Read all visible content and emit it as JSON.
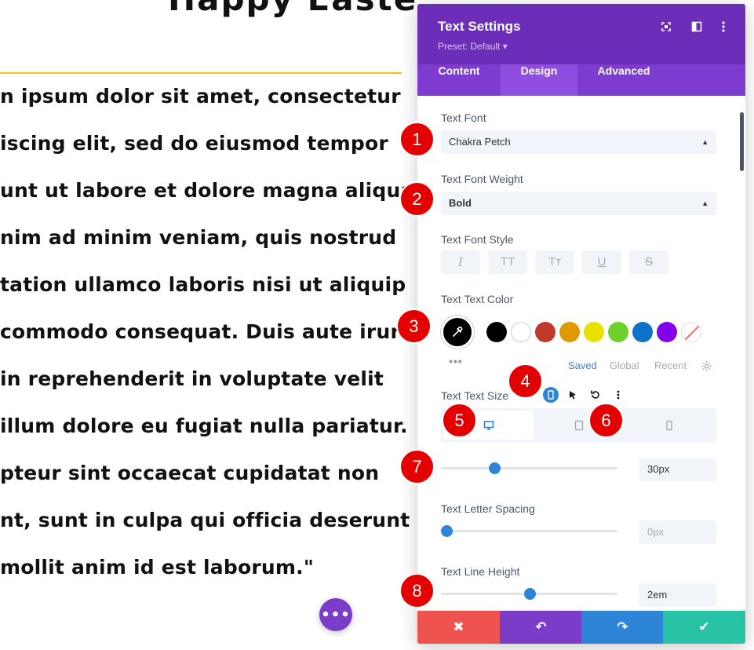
{
  "canvas": {
    "heading": "Happy Easter",
    "lines": [
      "n ipsum dolor sit amet, consectetur",
      "iscing elit, sed do eiusmod tempor",
      "unt ut labore et dolore magna aliqua.",
      "nim ad minim veniam, quis nostrud",
      "tation ullamco laboris nisi ut aliquip",
      "commodo consequat. Duis aute irure",
      " in reprehenderit in voluptate velit",
      "illum dolore eu fugiat nulla pariatur.",
      "pteur sint occaecat cupidatat non",
      "nt, sunt in culpa qui officia deserunt",
      " mollit anim id est laborum.\""
    ],
    "fab_label": "•••",
    "accent_rule_color": "#f0c419"
  },
  "panel": {
    "title": "Text Settings",
    "preset": "Preset: Default ▾",
    "header_icons": [
      "fullscreen-icon",
      "split-view-icon",
      "kebab-menu-icon"
    ],
    "tabs": [
      "Content",
      "Design",
      "Advanced"
    ],
    "active_tab": "Design",
    "text_font": {
      "label": "Text Font",
      "value": "Chakra Petch"
    },
    "text_font_weight": {
      "label": "Text Font Weight",
      "value": "Bold"
    },
    "text_font_style": {
      "label": "Text Font Style",
      "buttons": [
        "I",
        "TT",
        "Tт",
        "U",
        "S"
      ]
    },
    "text_color": {
      "label": "Text Text Color",
      "selected": "#000000",
      "swatches": [
        "#000000",
        "#ffffff",
        "#c0392b",
        "#e09900",
        "#e7e200",
        "#6ed02a",
        "#0f72c9",
        "#8300e9",
        "none"
      ],
      "palette_tabs": [
        "Saved",
        "Global",
        "Recent"
      ],
      "more": "•••"
    },
    "text_size": {
      "label": "Text Text Size",
      "devices": [
        "desktop-icon",
        "tablet-icon",
        "phone-icon"
      ],
      "value": "30px",
      "slider_fraction": 0.3
    },
    "letter_spacing": {
      "label": "Text Letter Spacing",
      "value": "0px",
      "slider_fraction": 0.03
    },
    "line_height": {
      "label": "Text Line Height",
      "value": "2em",
      "slider_fraction": 0.5
    },
    "footer": {
      "cancel": "✖",
      "undo": "↶",
      "redo": "↷",
      "save": "✔"
    }
  },
  "badges": [
    "1",
    "2",
    "3",
    "4",
    "5",
    "6",
    "7",
    "8"
  ],
  "colors": {
    "header": "#6c2eb9",
    "tabs": "#7e3bd0",
    "accent_blue": "#2e85d8",
    "badge": "#e40000",
    "cancel": "#ef5350",
    "undo": "#7b3cc9",
    "redo": "#2e85d8",
    "save": "#28c2a6"
  }
}
